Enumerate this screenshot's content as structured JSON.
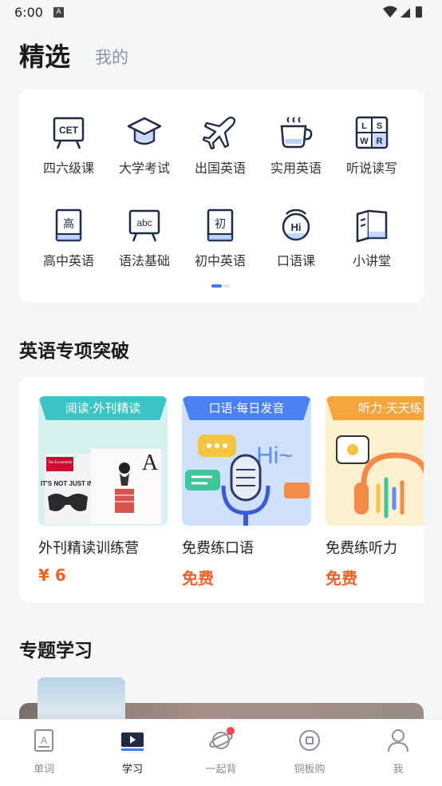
{
  "status_bar": {
    "time": "6:00",
    "notification_badge": "A"
  },
  "top_tabs": {
    "active": "精选",
    "inactive": "我的"
  },
  "categories": [
    {
      "label": "四六级课",
      "icon": "cet-board-icon",
      "badge": "CET"
    },
    {
      "label": "大学考试",
      "icon": "graduation-cap-icon"
    },
    {
      "label": "出国英语",
      "icon": "airplane-icon"
    },
    {
      "label": "实用英语",
      "icon": "coffee-cup-icon"
    },
    {
      "label": "听说读写",
      "icon": "lswr-grid-icon",
      "letters": [
        "L",
        "S",
        "W",
        "R"
      ]
    },
    {
      "label": "高中英语",
      "icon": "highschool-book-icon",
      "badge": "高"
    },
    {
      "label": "语法基础",
      "icon": "abc-board-icon",
      "badge": "abc"
    },
    {
      "label": "初中英语",
      "icon": "junior-book-icon",
      "badge": "初"
    },
    {
      "label": "口语课",
      "icon": "hi-speech-icon",
      "badge": "Hi"
    },
    {
      "label": "小讲堂",
      "icon": "open-book-icon"
    }
  ],
  "sections": {
    "special": "英语专项突破",
    "topic": "专题学习"
  },
  "courses": [
    {
      "ribbon": "阅读·外刊精读",
      "title": "外刊精读训练营",
      "price": "¥ 6",
      "ribbon_color": "#3cc3c3",
      "bg": "#d9f1ef",
      "magazine_brand": "The Economist",
      "headline": "IT'S NOT JUST IN"
    },
    {
      "ribbon": "口语·每日发音",
      "title": "免费练口语",
      "price": "免费",
      "ribbon_color": "#4a82f4",
      "bg": "#cfe0fb",
      "art_text": "Hi~"
    },
    {
      "ribbon": "听力·天天练",
      "title": "免费练听力",
      "price": "免费",
      "ribbon_color": "#f4a53c",
      "bg": "#fdf0cf"
    }
  ],
  "bottom_nav": [
    {
      "label": "单词",
      "icon": "word-card-icon",
      "active": false
    },
    {
      "label": "学习",
      "icon": "play-screen-icon",
      "active": true
    },
    {
      "label": "一起背",
      "icon": "planet-icon",
      "active": false,
      "dot": true
    },
    {
      "label": "铜板购",
      "icon": "coin-icon",
      "active": false
    },
    {
      "label": "我",
      "icon": "person-icon",
      "active": false
    }
  ],
  "colors": {
    "accent": "#3b7cf4",
    "price": "#f0612a",
    "icon_dark": "#1f2a44",
    "red_dot": "#f04848"
  }
}
